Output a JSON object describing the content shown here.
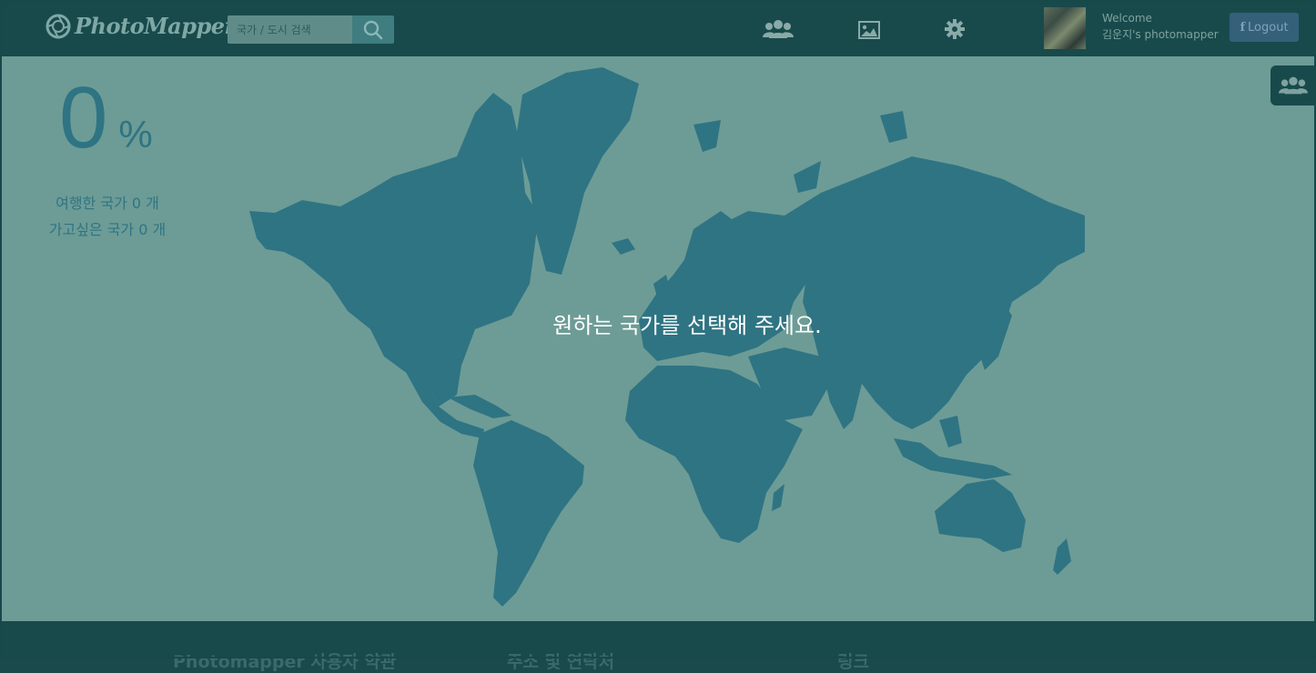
{
  "header": {
    "logo_text": "PhotoMapper",
    "search": {
      "placeholder": "국가 / 도시 검색",
      "value": ""
    },
    "nav_icons": [
      "users-icon",
      "image-icon",
      "gear-icon"
    ],
    "welcome": "Welcome",
    "username": "김운지's photomapper",
    "logout_label": "Logout"
  },
  "stats": {
    "percent": "0",
    "percent_sign": "%",
    "visited": "여행한 국가 0 개",
    "wished": "가고싶은 국가 0 개"
  },
  "map": {
    "prompt": "원하는 국가를 선택해 주세요."
  },
  "footer": {
    "terms": "Photomapper 사용자 약관",
    "contact": "주소 및 연락처",
    "links": "링크"
  },
  "colors": {
    "header_bg": "#184a4c",
    "map_bg": "#6d9c96",
    "land": "#2f7483",
    "logout_bg": "#34607a"
  }
}
